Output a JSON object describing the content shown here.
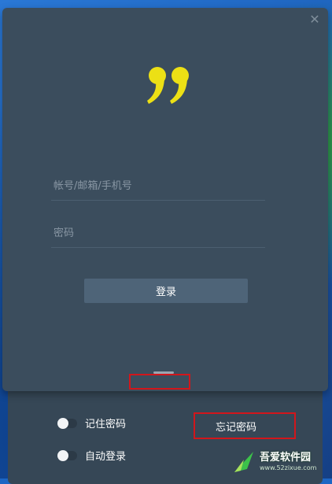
{
  "dialog": {
    "close_icon": "close-icon",
    "logo_icon": "quote-logo-icon",
    "logo_color": "#ece015",
    "background": "#3b4d5d"
  },
  "form": {
    "account_placeholder": "帐号/邮箱/手机号",
    "password_placeholder": "密码",
    "login_label": "登录",
    "login_button_color": "#4e6478"
  },
  "options": {
    "remember_label": "记住密码",
    "remember_checked": false,
    "auto_login_label": "自动登录",
    "auto_login_checked": false,
    "forgot_label": "忘记密码"
  },
  "annotations": {
    "highlight_color": "#d2161b"
  },
  "watermark": {
    "title": "吾爱软件园",
    "subtitle": "www.52zixue.com"
  }
}
